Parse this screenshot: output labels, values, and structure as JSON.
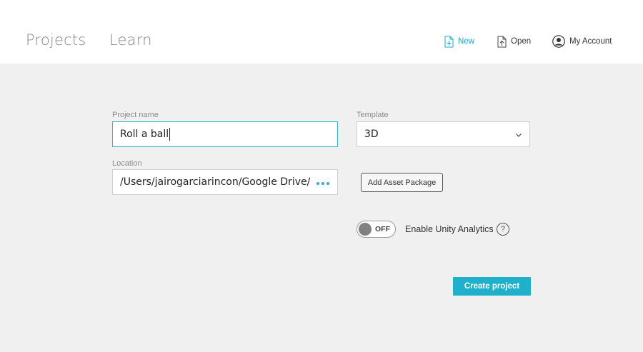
{
  "header": {
    "tabs": [
      {
        "label": "Projects"
      },
      {
        "label": "Learn"
      }
    ],
    "actions": {
      "new_label": "New",
      "open_label": "Open",
      "account_label": "My Account",
      "new_color": "#1fa8c6"
    }
  },
  "form": {
    "project_name": {
      "label": "Project name",
      "value": "Roll a ball"
    },
    "location": {
      "label": "Location",
      "value": "/Users/jairogarciarincon/Google Drive/"
    },
    "template": {
      "label": "Template",
      "value": "3D"
    },
    "add_asset_package_label": "Add Asset Package",
    "analytics": {
      "toggle_state": "OFF",
      "label": "Enable Unity Analytics",
      "help_glyph": "?"
    },
    "create_label": "Create project"
  },
  "colors": {
    "accent": "#1fb1cc",
    "background": "#f0f0f0"
  },
  "icons": [
    "new-file-icon",
    "open-file-icon",
    "account-icon",
    "chevron-down-icon",
    "help-icon",
    "more-dots-icon"
  ]
}
